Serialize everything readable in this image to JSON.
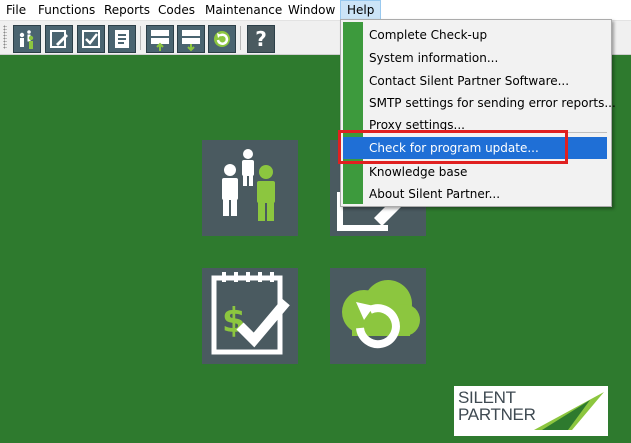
{
  "menubar": {
    "items": [
      {
        "label": "File"
      },
      {
        "label": "Functions"
      },
      {
        "label": "Reports"
      },
      {
        "label": "Codes"
      },
      {
        "label": "Maintenance"
      },
      {
        "label": "Window"
      },
      {
        "label": "Help"
      }
    ]
  },
  "toolbar": {
    "buttons": [
      {
        "icon": "people-icon"
      },
      {
        "icon": "edit-form-icon"
      },
      {
        "icon": "checklist-icon"
      },
      {
        "icon": "tax-form-icon"
      },
      {
        "icon": "upload-server-icon"
      },
      {
        "icon": "download-server-icon"
      },
      {
        "icon": "refresh-icon"
      },
      {
        "icon": "help-question-icon"
      }
    ],
    "help_glyph": "?"
  },
  "help_menu": {
    "items": [
      {
        "label": "Complete Check-up"
      },
      {
        "label": "System information..."
      },
      {
        "label": "Contact Silent Partner Software..."
      },
      {
        "label": "SMTP settings for sending error reports..."
      },
      {
        "label": "Proxy settings..."
      },
      {
        "label": "Check for program update..."
      },
      {
        "label": "Knowledge base"
      },
      {
        "label": "About Silent Partner..."
      }
    ],
    "highlighted_index": 5
  },
  "tiles": [
    {
      "icon": "people-icon"
    },
    {
      "icon": "edit-form-icon"
    },
    {
      "icon": "dollar-checklist-icon"
    },
    {
      "icon": "cloud-refresh-icon"
    }
  ],
  "logo": {
    "line1": "SILENT",
    "line2": "PARTNER"
  },
  "colors": {
    "desktop": "#2e7a2e",
    "tile": "#4a5a60",
    "accent_green": "#8cc63f",
    "menu_highlight": "#1f6fd6",
    "annotation": "#e02020"
  }
}
